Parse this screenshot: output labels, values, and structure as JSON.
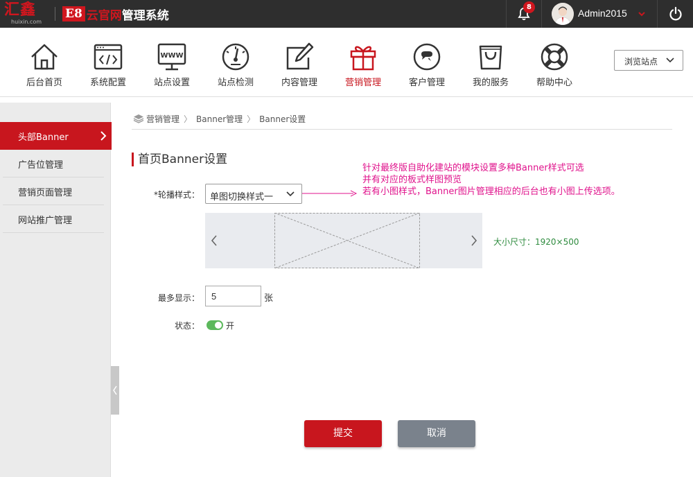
{
  "brand": {
    "logo_cn": "汇鑫",
    "logo_en": "huixin.com",
    "sys_e8": "E8",
    "sys_yun": "云官网",
    "sys_rest": "管理系统"
  },
  "topbar": {
    "notification_count": "8",
    "username": "Admin2015"
  },
  "nav": {
    "items": [
      {
        "label": "后台首页",
        "icon": "home-icon"
      },
      {
        "label": "系统配置",
        "icon": "code-window-icon"
      },
      {
        "label": "站点设置",
        "icon": "www-monitor-icon"
      },
      {
        "label": "站点检测",
        "icon": "gauge-icon"
      },
      {
        "label": "内容管理",
        "icon": "edit-icon"
      },
      {
        "label": "营销管理",
        "icon": "gift-icon",
        "active": true
      },
      {
        "label": "客户管理",
        "icon": "chat-icon"
      },
      {
        "label": "我的服务",
        "icon": "bag-icon"
      },
      {
        "label": "帮助中心",
        "icon": "lifebuoy-icon"
      }
    ],
    "browse_label": "浏览站点"
  },
  "sidebar": {
    "items": [
      {
        "label": "头部Banner",
        "active": true
      },
      {
        "label": "广告位管理"
      },
      {
        "label": "营销页面管理"
      },
      {
        "label": "网站推广管理"
      }
    ]
  },
  "breadcrumb": {
    "items": [
      "营销管理",
      "Banner管理",
      "Banner设置"
    ]
  },
  "section_title": "首页Banner设置",
  "annotation": {
    "line1": "针对最终版自助化建站的模块设置多种Banner样式可选",
    "line2": "并有对应的板式样图预览",
    "line3": "若有小图样式，Banner图片管理相应的后台也有小图上传选项。"
  },
  "form": {
    "carousel_label": "*轮播样式：",
    "carousel_value": "单图切换样式一",
    "size_text": "大小尺寸：1920×500",
    "max_label": "最多显示：",
    "max_value": "5",
    "max_unit": "张",
    "status_label": "状态：",
    "status_value": "开",
    "status_on": true
  },
  "buttons": {
    "submit": "提交",
    "cancel": "取消"
  },
  "colors": {
    "brand_red": "#c8161e",
    "annotation": "#e0138c",
    "size_text": "#2e8b3e",
    "toggle_on": "#5cb85c"
  }
}
